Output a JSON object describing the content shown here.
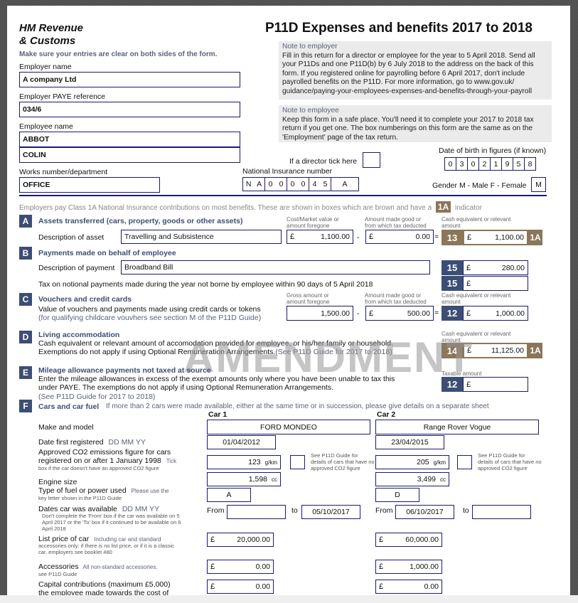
{
  "header": {
    "org_line1": "HM Revenue",
    "org_line2": "& Customs",
    "title": "P11D Expenses and benefits 2017 to 2018",
    "instruction": "Make sure your entries are clear on both sides of the form."
  },
  "notes": {
    "employer_title": "Note to employer",
    "employer_body": "Fill in this return for a director or employee for the year to 5 April 2018. Send all your P11Ds and one P11D(b) by 6 July 2018 to the address on the back of this form. If you registered online for payrolling before 6 April 2017, don't include payrolled benefits on the P11D. For more information, go to www.gov.uk/ guidance/paying-your-employees-expenses-and-benefits-through-your-payroll",
    "employee_title": "Note to employee",
    "employee_body": "Keep this form in a safe place. You'll need it to complete your 2017 to 2018 tax return if you get one. The box numberings on this form are the same as on the 'Employment' page of the tax return."
  },
  "employer": {
    "name_label": "Employer name",
    "name": "A company Ltd",
    "paye_label": "Employer PAYE reference",
    "paye": "034/6"
  },
  "employee": {
    "name_label": "Employee name",
    "surname": "ABBOT",
    "forename": "COLIN",
    "works_label": "Works number/department",
    "works": "OFFICE",
    "director_label": "If a director tick here",
    "director_checked": false,
    "ni_label": "National Insurance number",
    "ni_pairs": [
      [
        "N",
        "A"
      ],
      [
        "0",
        "0"
      ],
      [
        "0",
        "0"
      ],
      [
        "4",
        "5"
      ]
    ],
    "ni_suffix": "A",
    "dob_label": "Date of birth in figures (if known)",
    "dob_digits": [
      "0",
      "3",
      "0",
      "2",
      "1",
      "9",
      "5",
      "8"
    ],
    "gender_label": "Gender M - Male F - Female",
    "gender": "M"
  },
  "class1a_note": {
    "before": "Employers pay Class 1A National Insurance contributions on most benefits. These are shown in boxes which are brown and have a",
    "badge": "1A",
    "after": "indicator"
  },
  "watermark": "AMENDMENT",
  "sections": {
    "A": {
      "letter": "A",
      "title": "Assets transferred (cars, property, goods or other assets)",
      "col1_hdr": "Cost/Market value or amount foregone",
      "col2_hdr": "Amount made good or from which tax deducted",
      "col3_hdr": "Cash equivalent or relevant amount",
      "desc_label": "Description of asset",
      "desc": "Travelling and Subsistence",
      "cost": "1,100.00",
      "made_good": "0.00",
      "box": "13",
      "cash_equiv": "1,100.00",
      "indicator": "1A"
    },
    "B": {
      "letter": "B",
      "title": "Payments made on behalf of employee",
      "desc_label": "Description of payment",
      "desc": "Broadband Bill",
      "box": "15",
      "amount": "280.00",
      "tax_label": "Tax on notional payments made during the year not borne by employee within 90 days of 5 April 2018",
      "tax_box": "15",
      "tax_amount": ""
    },
    "C": {
      "letter": "C",
      "title": "Vouchers and credit cards",
      "body": "Value of vouchers and payments made using credit cards or tokens",
      "sub": "(for qualifying childcare vouvhers see section M of the P11D Guide)",
      "col1_hdr": "Gross amount or amount foregone",
      "col2_hdr": "Amount made good or from which tax deducted",
      "col3_hdr": "Cash equivalent or relevant amount",
      "gross": "1,500.00",
      "made_good": "500.00",
      "box": "12",
      "cash_equiv": "1,000.00"
    },
    "D": {
      "letter": "D",
      "title": "Living accommodation",
      "body": "Cash equivalent or relevant amount of accomodation provided for employee, or his/her family or household. Exemptions do not apply if using Optional Remuneration Arrangements.",
      "sub": "(See P11D Guide for 2017 to 2018)",
      "col_hdr": "Cash equivalent or relevant amount",
      "box": "14",
      "cash_equiv": "11,125.00",
      "indicator": "1A"
    },
    "E": {
      "letter": "E",
      "title": "Mileage allowance payments not taxed at source",
      "body": "Enter the mileage allowances in excess of the exempt amounts only where you have been unable to tax this under PAYE. The exemptions do not apply if using Optional Remuneration Arrangements.",
      "sub": "(See P11D Guide for 2017 to 2018)",
      "col_hdr": "Taxable amount",
      "box": "12",
      "amount": ""
    },
    "F": {
      "letter": "F",
      "title": "Cars and car fuel",
      "note": "If more than 2 cars were made available, either at the same time or in succession, please give details on a separate sheet",
      "car1_hdr": "Car 1",
      "car2_hdr": "Car 2",
      "labels": {
        "make": "Make and model",
        "date_reg": "Date first registered",
        "date_fmt": "DD MM YY",
        "co2_l1": "Approved CO2 emissions figure for cars",
        "co2_l2": "registered on or after 1 January 1998",
        "co2_tick": "Tick",
        "co2_sub": "box if the car doesn't have an approved CO2 figure",
        "co2_note": "See P11D Guide for details of cars that have no approved CO2 figure",
        "engine": "Engine size",
        "fuel": "Type of fuel or power used",
        "fuel_hint": "Please use the",
        "fuel_sub": "key letter shown in the P11D Guide",
        "dates": "Dates car was available",
        "dates_sub": "Don't complete the 'From' box if the car was available on 5 April 2017 or the 'To' box if it continued to be available on 6 April 2018",
        "from": "From",
        "to": "to",
        "list_price": "List price of car",
        "list_hint": "Including car and standard",
        "list_sub": "accessories only: if there is no list price, or if it is a classic car, employers see booklet 480",
        "accessories": "Accessories",
        "acc_hint": "All non-standard accessories,",
        "acc_sub": "see P11D Guide",
        "capital_l1": "Capital contributions (maximum £5,000)",
        "capital_l2": "the employee made towards the cost of",
        "gkm": "g/km",
        "cc": "cc",
        "currency": "£"
      },
      "car1": {
        "make": "FORD MONDEO",
        "date_reg": "01/04/2012",
        "co2": "123",
        "no_co2": false,
        "engine": "1,598",
        "fuel": "A",
        "from": "",
        "to": "05/10/2017",
        "list_price": "20,000.00",
        "accessories": "0.00",
        "capital": "0.00"
      },
      "car2": {
        "make": "Range Rover Vogue",
        "date_reg": "23/04/2015",
        "co2": "205",
        "no_co2": false,
        "engine": "3,499",
        "fuel": "D",
        "from": "06/10/2017",
        "to": "",
        "list_price": "60,000.00",
        "accessories": "1,000.00",
        "capital": "0.00"
      }
    }
  },
  "currency": "£",
  "minus": "-",
  "equals": "="
}
